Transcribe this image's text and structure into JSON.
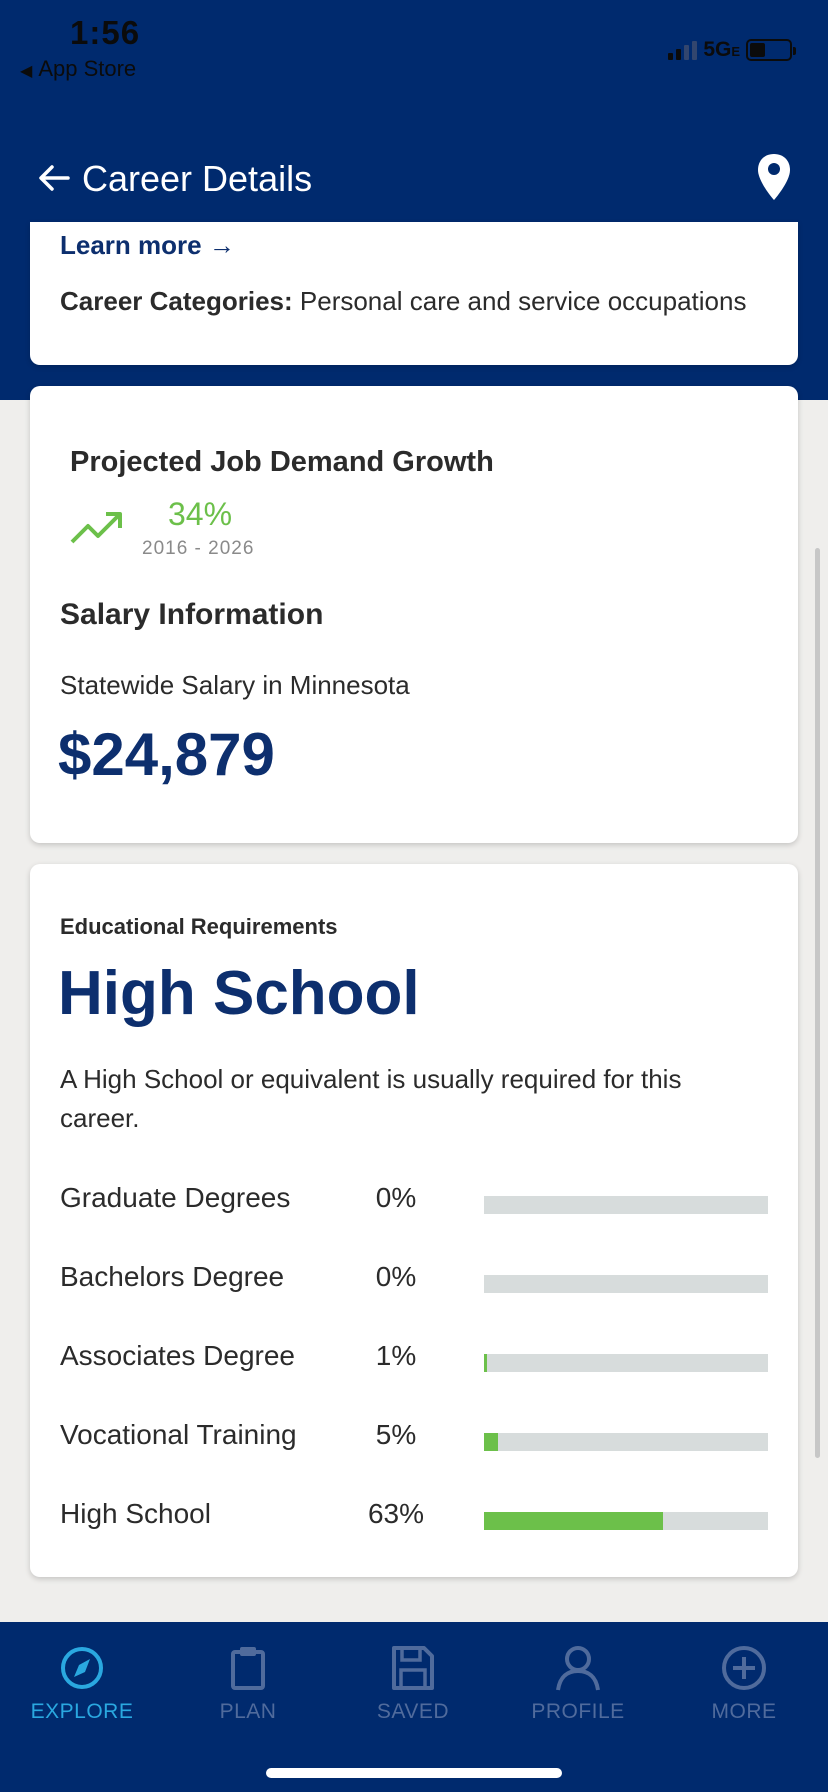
{
  "status_bar": {
    "time": "1:56",
    "back_app": "App Store",
    "network": "5G",
    "network_suffix": "E"
  },
  "header": {
    "title": "Career Details"
  },
  "overview": {
    "learn_more": "Learn more →",
    "categories_label": "Career Categories:",
    "categories_value": "Personal care and service occupations"
  },
  "growth": {
    "title": "Projected Job Demand Growth",
    "percent": "34%",
    "years": "2016 - 2026"
  },
  "salary": {
    "title": "Salary Information",
    "subtitle": "Statewide Salary in Minnesota",
    "amount": "$24,879"
  },
  "education": {
    "label": "Educational Requirements",
    "title": "High School",
    "description": "A High School or equivalent is usually required for this career.",
    "rows": [
      {
        "label": "Graduate Degrees",
        "percent": "0%",
        "value": 0
      },
      {
        "label": "Bachelors Degree",
        "percent": "0%",
        "value": 0
      },
      {
        "label": "Associates Degree",
        "percent": "1%",
        "value": 1
      },
      {
        "label": "Vocational Training",
        "percent": "5%",
        "value": 5
      },
      {
        "label": "High School",
        "percent": "63%",
        "value": 63
      }
    ]
  },
  "tabs": [
    {
      "label": "EXPLORE",
      "icon": "compass-icon",
      "active": true
    },
    {
      "label": "PLAN",
      "icon": "clipboard-icon",
      "active": false
    },
    {
      "label": "SAVED",
      "icon": "floppy-disk-icon",
      "active": false
    },
    {
      "label": "PROFILE",
      "icon": "person-icon",
      "active": false
    },
    {
      "label": "MORE",
      "icon": "plus-circle-icon",
      "active": false
    }
  ],
  "colors": {
    "brand_navy": "#002a6e",
    "accent_green": "#6cc04a",
    "active_tab": "#2aa8e0",
    "inactive_tab": "#506b9c"
  }
}
